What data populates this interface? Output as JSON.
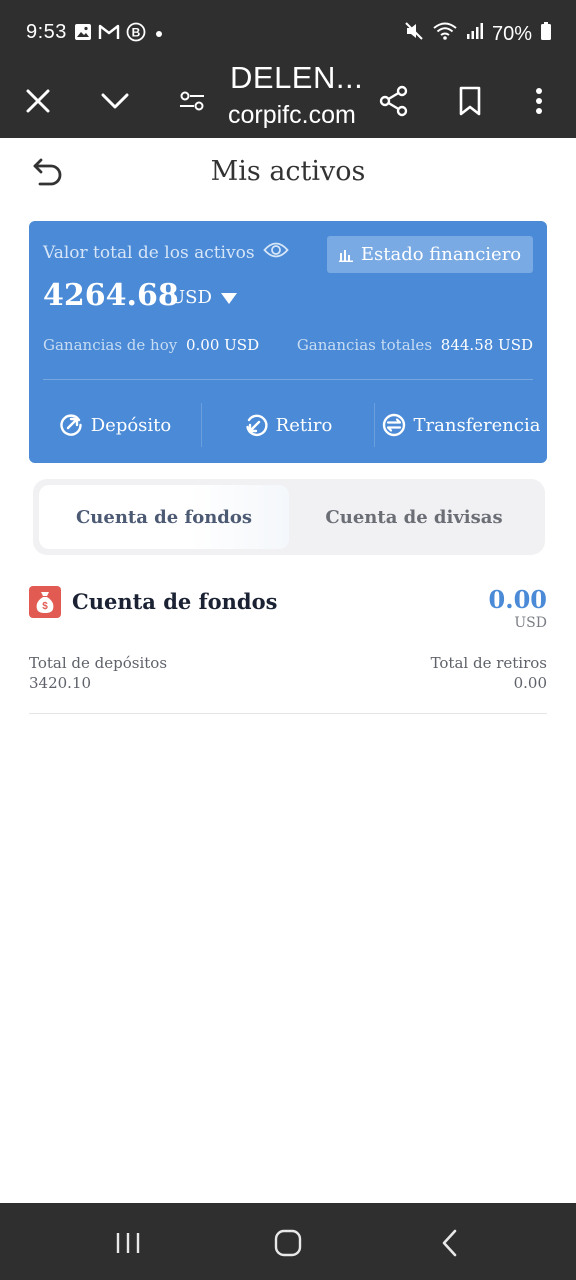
{
  "status_bar": {
    "time": "9:53",
    "battery": "70%",
    "notification_icons": [
      "gallery-icon",
      "gmail-icon",
      "b-app-icon",
      "dot-icon"
    ],
    "system_icons": [
      "mute-icon",
      "wifi-icon",
      "signal-icon",
      "battery-icon"
    ]
  },
  "browser": {
    "title": "DELEN...",
    "url": "corpifc.com"
  },
  "page": {
    "title": "Mis activos"
  },
  "assets": {
    "total_label": "Valor total de los activos",
    "statement_button": "Estado financiero",
    "total_amount": "4264.68",
    "currency": "USD",
    "today_label": "Ganancias de hoy",
    "today_value": "0.00 USD",
    "total_earnings_label": "Ganancias totales",
    "total_earnings_value": "844.58 USD",
    "actions": {
      "deposit": "Depósito",
      "withdraw": "Retiro",
      "transfer": "Transferencia"
    }
  },
  "tabs": {
    "funds": "Cuenta de fondos",
    "currency": "Cuenta de divisas",
    "active": "funds"
  },
  "fund_account": {
    "title": "Cuenta de fondos",
    "amount": "0.00",
    "currency": "USD",
    "deposits_label": "Total de depósitos",
    "deposits_value": "3420.10",
    "withdrawals_label": "Total de retiros",
    "withdrawals_value": "0.00"
  },
  "colors": {
    "card_blue": "#4a8ad6",
    "amount_blue": "#4a8ad6",
    "fund_icon_red": "#e25b52",
    "system_bar": "#2f2f2f"
  }
}
